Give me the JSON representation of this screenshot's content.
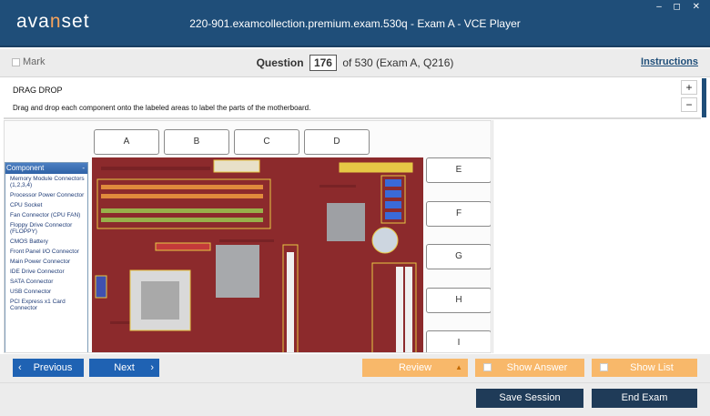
{
  "app": {
    "logo_pre": "ava",
    "logo_accent": "n",
    "logo_post": "set",
    "title": "220-901.examcollection.premium.exam.530q - Exam A - VCE Player",
    "controls": "– ◻ ✕"
  },
  "question_bar": {
    "mark_label": "Mark",
    "question_label": "Question",
    "question_number": "176",
    "question_of": "of 530 (Exam A, Q216)",
    "instructions_label": "Instructions"
  },
  "question": {
    "title": "DRAG DROP",
    "description": "Drag and drop each component onto the labeled areas to label the parts of the motherboard.",
    "zoom_in": "+",
    "zoom_out": "−"
  },
  "targets_top": [
    "A",
    "B",
    "C",
    "D"
  ],
  "targets_side": [
    "E",
    "F",
    "G",
    "H",
    "I"
  ],
  "component_panel": {
    "header": "Component",
    "collapse": "-",
    "items": [
      "Memory Module Connectors (1,2,3,4)",
      "Processor Power Connector",
      "CPU Socket",
      "Fan Connector (CPU FAN)",
      "Floppy Drive Connector (FLOPPY)",
      "CMOS Battery",
      "Front Panel I/O Connector",
      "Main Power Connector",
      "IDE Drive Connector",
      "SATA Connector",
      "USB Connector",
      "PCI Express x1 Card Connector"
    ]
  },
  "footer": {
    "previous": "Previous",
    "next": "Next",
    "review": "Review",
    "show_answer": "Show Answer",
    "show_list": "Show List",
    "save_session": "Save Session",
    "end_exam": "End Exam"
  },
  "colors": {
    "titlebar": "#1f4e79",
    "accent_orange": "#f8b86a",
    "nav_blue": "#1f62b3",
    "dark_button": "#1f3b58"
  }
}
